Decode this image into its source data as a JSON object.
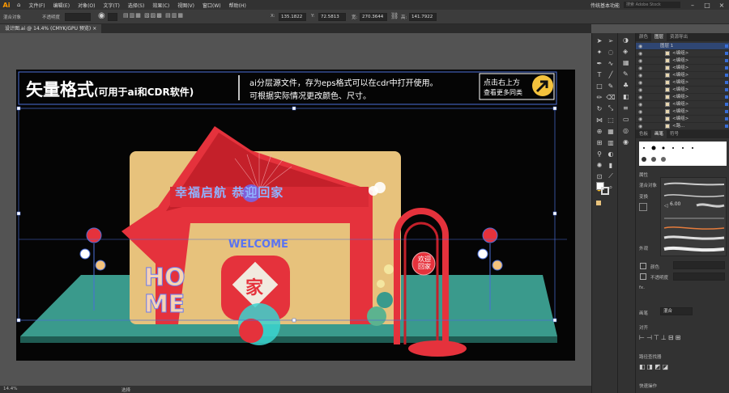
{
  "app": {
    "logo": "Ai"
  },
  "menubar": {
    "items": [
      "文件(F)",
      "编辑(E)",
      "对象(O)",
      "文字(T)",
      "选择(S)",
      "效果(C)",
      "视图(V)",
      "窗口(W)",
      "帮助(H)"
    ],
    "workspace": "传统基本功能",
    "search_placeholder": "搜索 Adobe Stock"
  },
  "control_bar": {
    "selection": "混合对象",
    "opacity_label": "不透明度",
    "x": "135.1822",
    "y": "72.5813",
    "w": "270.3644",
    "h": "141.7922"
  },
  "document": {
    "tab_title": "设计图.ai @ 14.4% (CMYK/GPU 预览)",
    "zoom": "14.4%",
    "status_tool": "选择"
  },
  "artwork": {
    "headline": "矢量格式",
    "headline_sub": "(可用于ai和CDR软件)",
    "info_line1": "ai分层源文件，存为eps格式可以在cdr中打开使用。",
    "info_line2": "可根据实际情况更改颜色、尺寸。",
    "cta_line1": "点击右上方",
    "cta_line2": "查看更多同类",
    "arch_text": "幸福启航 恭迎回家",
    "welcome": "WELCOME",
    "home1": "HO",
    "home2": "ME",
    "circle_text": "欢迎回家",
    "center_char": "家"
  },
  "layers_panel": {
    "tabs": [
      "颜色",
      "图层",
      "资源导出"
    ],
    "active_tab": "图层",
    "rows": [
      "图层 1",
      "<编组>",
      "<编组>",
      "<编组>",
      "<编组>",
      "<编组>",
      "<编组>",
      "<编组>",
      "<编组>",
      "<编组>",
      "<编组>",
      "<路...",
      "<..."
    ]
  },
  "brush_panel": {
    "tabs": [
      "色板",
      "画笔",
      "符号"
    ],
    "active_tab": "画笔",
    "size_value": "6.00"
  },
  "properties_panel": {
    "title": "属性",
    "group_label": "混合对象",
    "transform_label": "变换",
    "appearance_label": "外观",
    "fill_label": "颜色",
    "opacity_label": "不透明度",
    "fx_label": "fx.",
    "blend_label": "画笔",
    "blend_mode": "混合",
    "align_label": "对齐",
    "pathfinder_label": "路径查找器",
    "quick_label": "快速操作"
  },
  "colors": {
    "accent": "#3a6dd8",
    "arch_red": "#e5323c",
    "floor_teal": "#3a9a8c",
    "gold_panel": "#e7c27c",
    "ui_dark": "#323232"
  }
}
